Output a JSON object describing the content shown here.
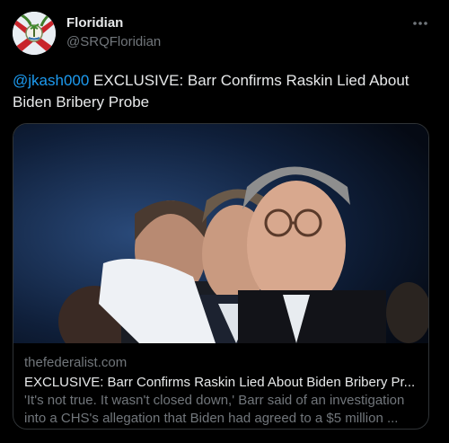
{
  "author": {
    "display_name": "Floridian",
    "handle": "@SRQFloridian",
    "avatar_icon": "florida-flag-avatar"
  },
  "menu": {
    "more_icon": "more-horizontal-icon"
  },
  "tweet": {
    "mention": "@jkash000",
    "text": " EXCLUSIVE: Barr Confirms Raskin Lied About Biden Bribery Probe"
  },
  "card": {
    "image_alt": "photo",
    "domain": "thefederalist.com",
    "title": "EXCLUSIVE: Barr Confirms Raskin Lied About Biden Bribery Pr...",
    "description": "'It's not true. It wasn't closed down,' Barr said of an investigation into a CHS's allegation that Biden had agreed to a $5 million ..."
  },
  "colors": {
    "background": "#000000",
    "text_primary": "#e7e9ea",
    "text_secondary": "#71767b",
    "link": "#1d9bf0",
    "border": "#2f3336"
  }
}
